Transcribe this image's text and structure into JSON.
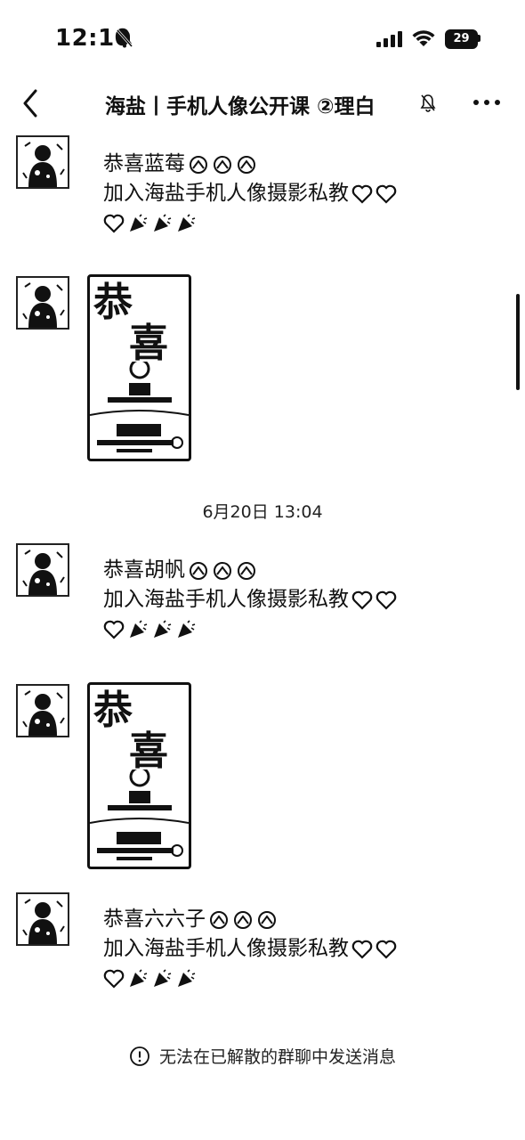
{
  "status_bar": {
    "time": "12:10",
    "battery": "29",
    "icons": [
      "bell-off-icon",
      "signal-icon",
      "wifi-icon",
      "battery-icon"
    ]
  },
  "nav": {
    "title": "海盐丨手机人像公开课 ②理白",
    "back_icon": "chevron-left-icon",
    "mute_icon": "bell-off-icon",
    "more_icon": "ellipsis-icon"
  },
  "messages": [
    {
      "type": "text",
      "line1": "恭喜蓝莓",
      "line2": "加入海盐手机人像摄影私教",
      "emojis_line1": [
        "fireworks-emoji",
        "fireworks-emoji",
        "fireworks-emoji"
      ]
    },
    {
      "type": "image",
      "poster_text": [
        "恭",
        "喜"
      ]
    },
    {
      "type": "text",
      "line1": "恭喜胡帆",
      "line2": "加入海盐手机人像摄影私教",
      "emojis_line1": [
        "fireworks-emoji",
        "fireworks-emoji",
        "fireworks-emoji"
      ]
    },
    {
      "type": "image",
      "poster_text": [
        "恭",
        "喜"
      ]
    },
    {
      "type": "text",
      "line1": "恭喜六六子",
      "line2": "加入海盐手机人像摄影私教",
      "emojis_line1": [
        "fireworks-emoji",
        "fireworks-emoji",
        "fireworks-emoji"
      ]
    }
  ],
  "time_separator": "6月20日 13:04",
  "notice": "无法在已解散的群聊中发送消息",
  "colors": {
    "foreground": "#111111",
    "background": "#ffffff"
  }
}
